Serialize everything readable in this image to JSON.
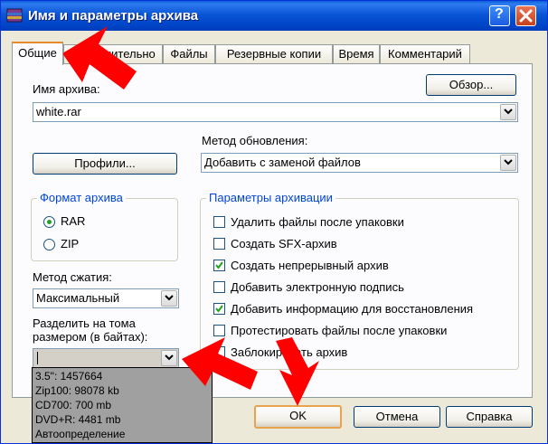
{
  "window": {
    "title": "Имя и параметры архива"
  },
  "tabs": [
    "Общие",
    "Дополнительно",
    "Файлы",
    "Резервные копии",
    "Время",
    "Комментарий"
  ],
  "archive_name": {
    "label": "Имя архива:",
    "value": "white.rar",
    "browse_button": "Обзор..."
  },
  "update_method": {
    "label": "Метод обновления:",
    "value": "Добавить с заменой файлов"
  },
  "profiles_button": "Профили...",
  "archive_format": {
    "title": "Формат архива",
    "options": [
      "RAR",
      "ZIP"
    ],
    "selected": "RAR"
  },
  "compression": {
    "label": "Метод сжатия:",
    "value": "Максимальный"
  },
  "split": {
    "label_line1": "Разделить на тома",
    "label_line2": "размером (в байтах):",
    "value": ""
  },
  "split_options": [
    "3.5\":      1457664",
    "Zip100:   98078 kb",
    "CD700:    700 mb",
    "DVD+R: 4481 mb",
    "Автоопределение"
  ],
  "archiving_params": {
    "title": "Параметры архивации",
    "items": [
      {
        "label": "Удалить файлы после упаковки",
        "checked": false
      },
      {
        "label": "Создать SFX-архив",
        "checked": false
      },
      {
        "label": "Создать непрерывный архив",
        "checked": true
      },
      {
        "label": "Добавить электронную подпись",
        "checked": false
      },
      {
        "label": "Добавить информацию для восстановления",
        "checked": true
      },
      {
        "label": "Протестировать файлы после упаковки",
        "checked": false
      },
      {
        "label": "Заблокировать архив",
        "checked": false
      }
    ]
  },
  "buttons": {
    "ok": "OK",
    "cancel": "Отмена",
    "help": "Справка"
  },
  "colors": {
    "arrow": "#ff0000",
    "titlebar": "#0a55d6",
    "group_title": "#0046d5"
  }
}
